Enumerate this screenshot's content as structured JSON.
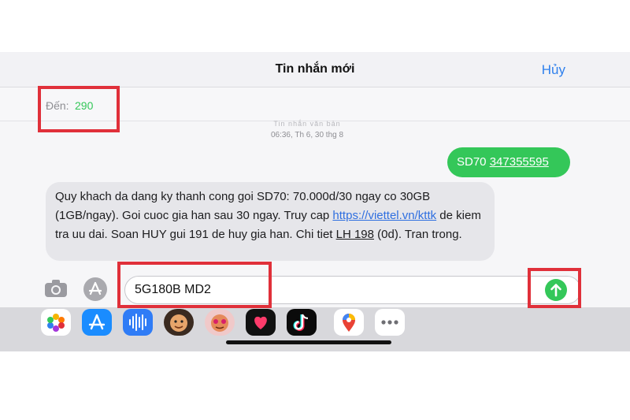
{
  "header": {
    "title": "Tin nhắn mới",
    "cancel_label": "Hủy"
  },
  "recipient": {
    "label": "Đến:",
    "value": "290"
  },
  "conversation": {
    "timestamp_faint": "Tin nhắn văn bản",
    "timestamp": "06:36, Th 6, 30 thg 8",
    "outgoing": {
      "code": "SD70",
      "number": "347355595"
    },
    "incoming": {
      "text_1": "Quy khach da dang ky thanh cong goi SD70: 70.000d/30 ngay co 30GB (1GB/ngay). Goi cuoc gia han sau 30 ngay. Truy cap ",
      "link": "https://viettel.vn/kttk",
      "text_2": " de kiem tra uu dai. Soan HUY gui 191 de huy gia han. Chi tiet ",
      "underlined": "LH 198",
      "text_3": " (0d). Tran trong."
    }
  },
  "composer": {
    "value": "5G180B MD2"
  },
  "app_drawer": [
    {
      "name": "photos-icon"
    },
    {
      "name": "app-store-icon"
    },
    {
      "name": "audio-message-icon"
    },
    {
      "name": "memoji-icon"
    },
    {
      "name": "memoji-stickers-icon"
    },
    {
      "name": "digital-touch-icon"
    },
    {
      "name": "tiktok-icon"
    },
    {
      "name": "google-maps-icon"
    },
    {
      "name": "more-apps-icon"
    }
  ],
  "colors": {
    "accent_green": "#34c759",
    "link_blue": "#2f80ed",
    "highlight_red": "#e0303a"
  }
}
